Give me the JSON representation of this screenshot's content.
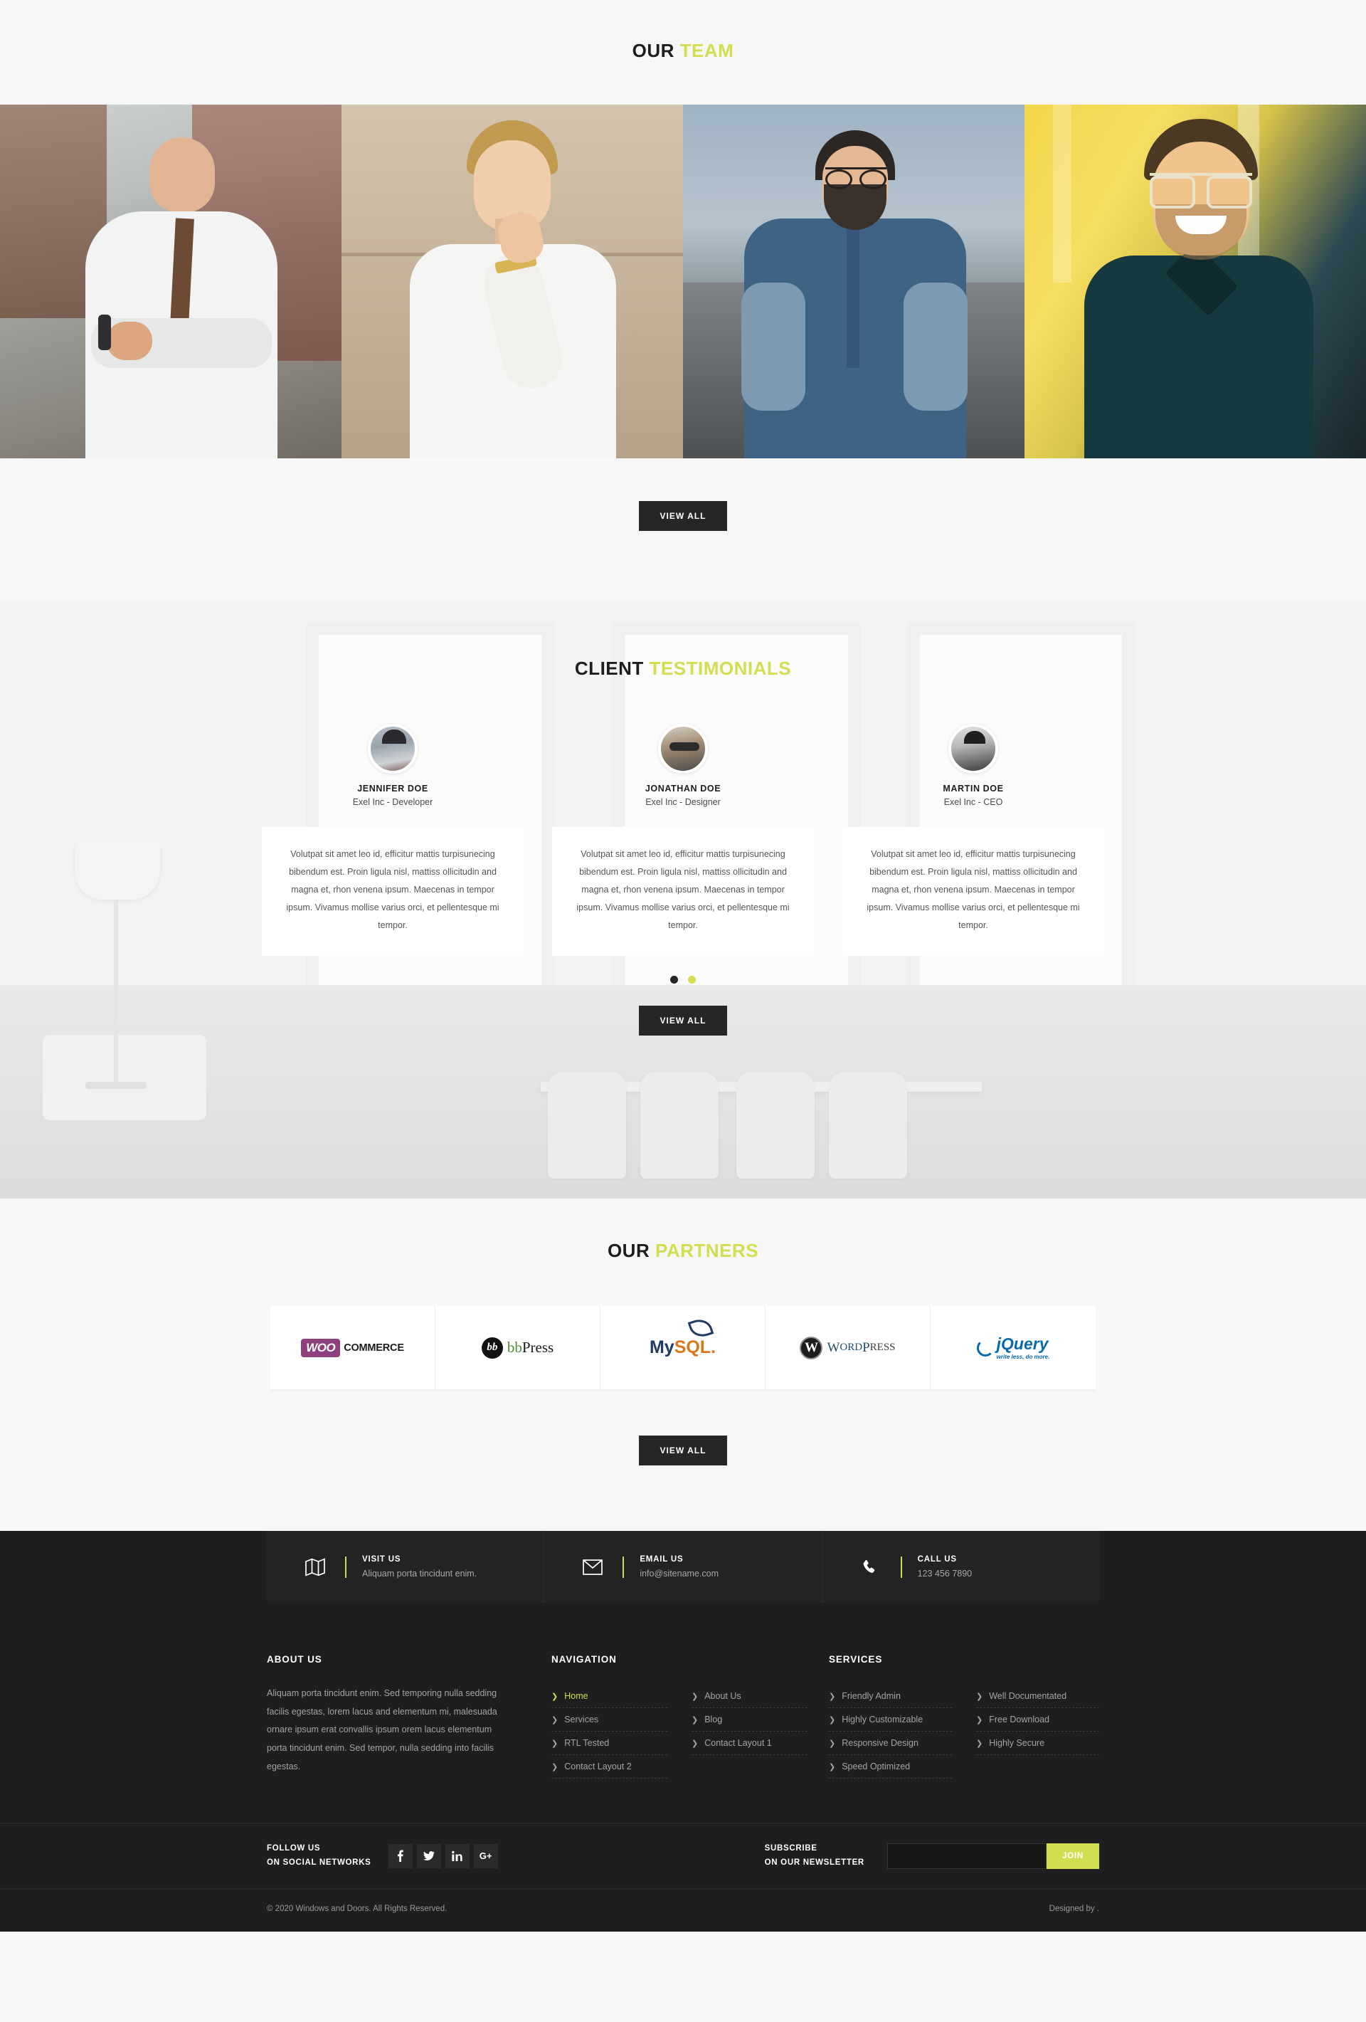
{
  "team": {
    "heading_plain": "OUR",
    "heading_accent": "TEAM",
    "members": [
      {
        "alt": "team-member-photo-1"
      },
      {
        "alt": "team-member-photo-2"
      },
      {
        "alt": "team-member-photo-3"
      },
      {
        "alt": "team-member-photo-4"
      }
    ],
    "view_all": "VIEW ALL"
  },
  "testimonials": {
    "heading_plain": "CLIENT",
    "heading_accent": "TESTIMONIALS",
    "items": [
      {
        "name": "JENNIFER DOE",
        "role": "Exel Inc - Developer",
        "quote": "Volutpat sit amet leo id, efficitur mattis turpisunecing bibendum est. Proin ligula nisl, mattiss ollicitudin and magna et, rhon venena ipsum. Maecenas in tempor ipsum. Vivamus mollise varius orci, et pellentesque mi tempor."
      },
      {
        "name": "JONATHAN DOE",
        "role": "Exel Inc - Designer",
        "quote": "Volutpat sit amet leo id, efficitur mattis turpisunecing bibendum est. Proin ligula nisl, mattiss ollicitudin and magna et, rhon venena ipsum. Maecenas in tempor ipsum. Vivamus mollise varius orci, et pellentesque mi tempor."
      },
      {
        "name": "MARTIN DOE",
        "role": "Exel Inc - CEO",
        "quote": "Volutpat sit amet leo id, efficitur mattis turpisunecing bibendum est. Proin ligula nisl, mattiss ollicitudin and magna et, rhon venena ipsum. Maecenas in tempor ipsum. Vivamus mollise varius orci, et pellentesque mi tempor."
      }
    ],
    "slides": 2,
    "active_slide": 2,
    "view_all": "VIEW ALL"
  },
  "partners": {
    "heading_plain": "OUR",
    "heading_accent": "PARTNERS",
    "logos": [
      {
        "name": "woocommerce-logo",
        "mark": "WOO",
        "text": "COMMERCE"
      },
      {
        "name": "bbpress-logo",
        "mark": "bb",
        "text1": "bb",
        "text2": "Press"
      },
      {
        "name": "mysql-logo",
        "text1": "My",
        "text2": "SQL."
      },
      {
        "name": "wordpress-logo",
        "mark": "W",
        "text1": "W",
        "text2": "ORD",
        "text3": "P",
        "text4": "RESS"
      },
      {
        "name": "jquery-logo",
        "text": "jQuery",
        "sub": "write less, do more."
      }
    ],
    "view_all": "VIEW ALL"
  },
  "footer": {
    "contact": [
      {
        "icon": "map-icon",
        "label": "VISIT US",
        "value": "Aliquam porta tincidunt enim."
      },
      {
        "icon": "envelope-icon",
        "label": "EMAIL US",
        "value": "info@sitename.com"
      },
      {
        "icon": "phone-icon",
        "label": "CALL US",
        "value": "123 456 7890"
      }
    ],
    "about": {
      "title": "ABOUT US",
      "text": "Aliquam porta tincidunt enim. Sed temporing nulla sedding facilis egestas, lorem lacus and elementum mi, malesuada ornare ipsum erat convallis ipsum orem lacus elementum porta tincidunt enim. Sed tempor, nulla sedding into facilis egestas."
    },
    "navigation": {
      "title": "NAVIGATION",
      "col1": [
        "Home",
        "Services",
        "RTL Tested",
        "Contact Layout 2"
      ],
      "col2": [
        "About Us",
        "Blog",
        "Contact Layout 1"
      ],
      "active": "Home"
    },
    "services": {
      "title": "SERVICES",
      "col1": [
        "Friendly Admin",
        "Highly Customizable",
        "Responsive Design",
        "Speed Optimized"
      ],
      "col2": [
        "Well Documentated",
        "Free Download",
        "Highly Secure"
      ]
    },
    "follow": {
      "line1": "FOLLOW US",
      "line2": "ON SOCIAL NETWORKS",
      "icons": [
        {
          "name": "facebook-icon",
          "glyph": "f"
        },
        {
          "name": "twitter-icon",
          "glyph": "ᴠ"
        },
        {
          "name": "linkedin-icon",
          "glyph": "in"
        },
        {
          "name": "google-plus-icon",
          "glyph": "G+"
        }
      ]
    },
    "subscribe": {
      "line1": "SUBSCRIBE",
      "line2": "ON OUR NEWSLETTER",
      "input_value": "",
      "input_placeholder": "",
      "button": "JOIN"
    },
    "copyright": "© 2020 Windows and Doors. All Rights Reserved.",
    "designed_by": "Designed by ."
  },
  "colors": {
    "accent": "#d2dd4f",
    "dark": "#1e1e1e",
    "button_dark": "#262626"
  }
}
